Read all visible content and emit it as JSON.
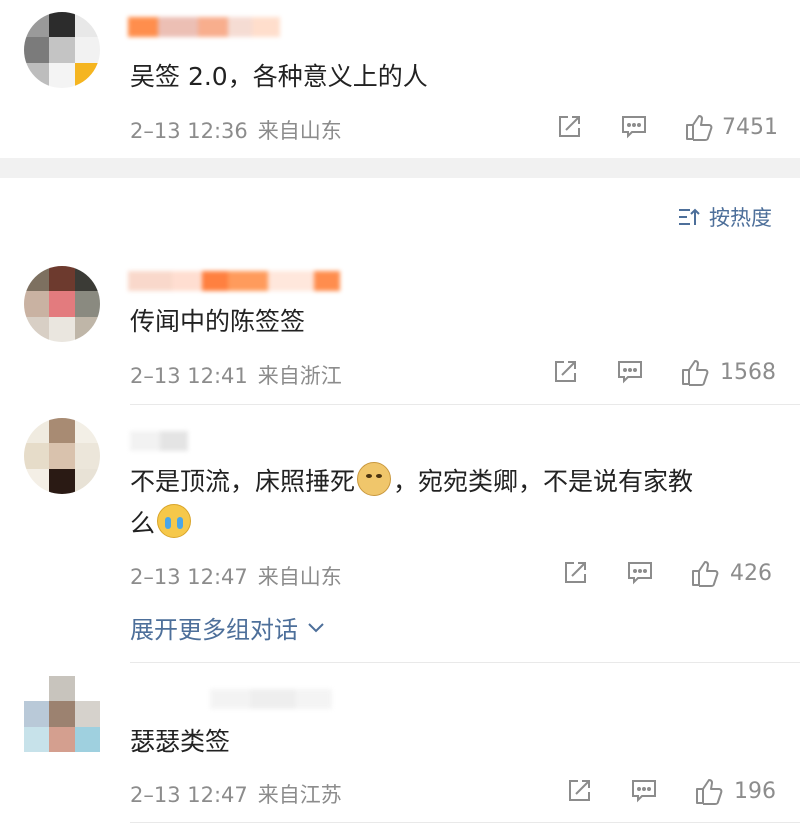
{
  "comments": [
    {
      "text": "吴签 2.0，各种意义上的人",
      "date": "2–13 12:36",
      "location": "来自山东",
      "likes": "7451"
    },
    {
      "text": "传闻中的陈签签",
      "date": "2–13 12:41",
      "location": "来自浙江",
      "likes": "1568"
    },
    {
      "text_line1_a": "不是顶流，床照捶死",
      "text_line1_b": "，宛宛类卿，不是说有家教",
      "text_line2": "么",
      "date": "2–13 12:47",
      "location": "来自山东",
      "likes": "426"
    },
    {
      "text": "瑟瑟类签",
      "date": "2–13 12:47",
      "location": "来自江苏",
      "likes": "196"
    }
  ],
  "sort_label": "按热度",
  "expand_label": "展开更多组对话",
  "colors": {
    "meta": "#8c8c8c",
    "link": "#4d6f9a",
    "divider": "#e9e9e9"
  },
  "icons": [
    "share-icon",
    "comment-icon",
    "like-icon",
    "sort-icon",
    "chevron-down-icon"
  ]
}
